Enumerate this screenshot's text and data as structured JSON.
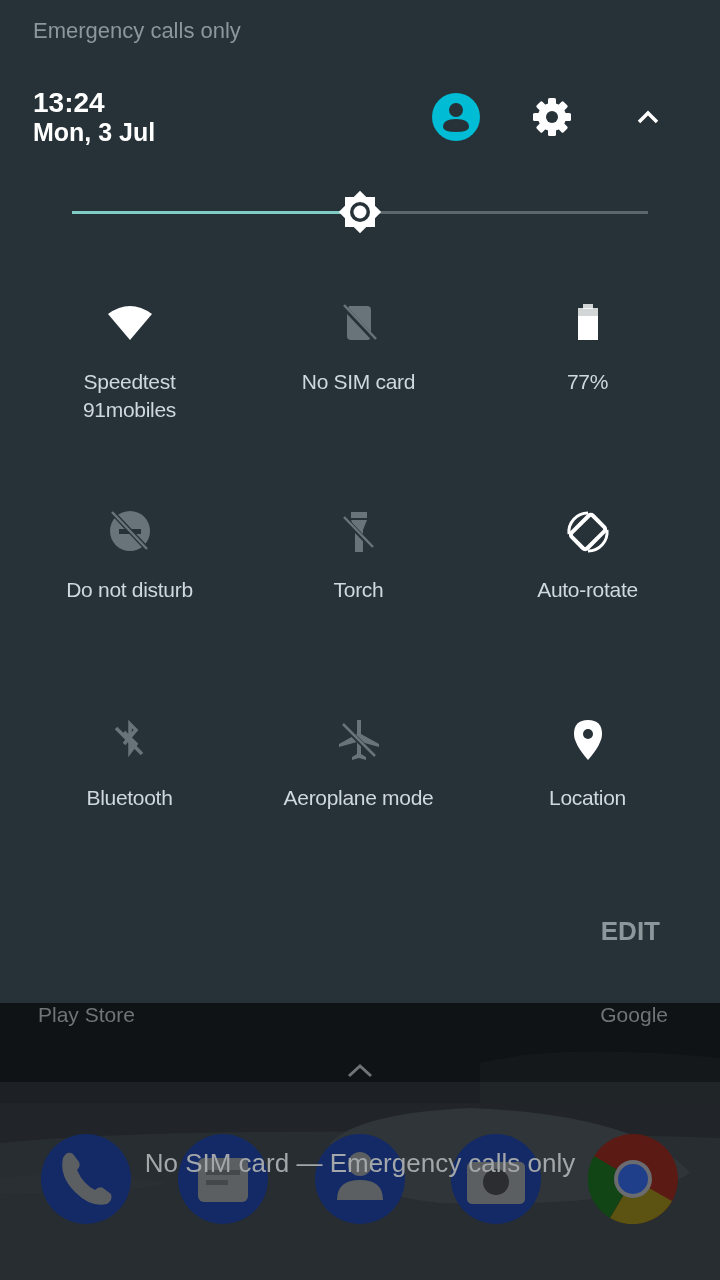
{
  "status_text": "Emergency calls only",
  "header": {
    "time": "13:24",
    "date": "Mon, 3 Jul"
  },
  "brightness": {
    "level": 0.5
  },
  "tiles": [
    {
      "kind": "wifi",
      "label": "Speedtest\n91mobiles",
      "on": true
    },
    {
      "kind": "sim",
      "label": "No SIM card",
      "on": false
    },
    {
      "kind": "battery",
      "label": "77%",
      "on": true
    },
    {
      "kind": "dnd",
      "label": "Do not disturb",
      "on": false
    },
    {
      "kind": "torch",
      "label": "Torch",
      "on": false
    },
    {
      "kind": "rotate",
      "label": "Auto-rotate",
      "on": true
    },
    {
      "kind": "bluetooth",
      "label": "Bluetooth",
      "on": false
    },
    {
      "kind": "airplane",
      "label": "Aeroplane mode",
      "on": false
    },
    {
      "kind": "location",
      "label": "Location",
      "on": true
    }
  ],
  "edit_button": "EDIT",
  "home": {
    "app_labels": [
      "Play Store",
      "Google"
    ],
    "dock": [
      {
        "kind": "phone"
      },
      {
        "kind": "messages"
      },
      {
        "kind": "contacts"
      },
      {
        "kind": "camera"
      },
      {
        "kind": "browser"
      }
    ],
    "overlay_text": "No SIM card — Emergency calls only"
  }
}
